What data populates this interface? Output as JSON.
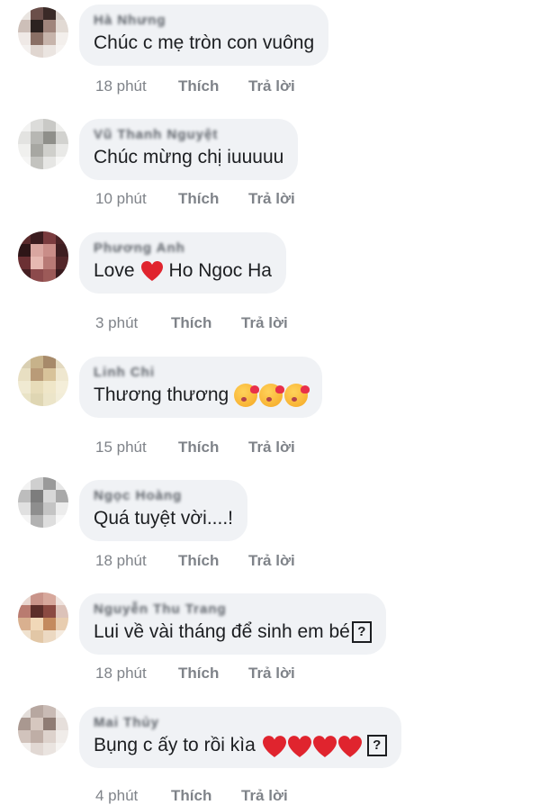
{
  "comments": [
    {
      "author": "Hà Nhưng",
      "text": "Chúc c mẹ tròn con vuông",
      "time": "18 phút",
      "like": "Thích",
      "reply": "Trả lời"
    },
    {
      "author": "Vũ Thanh Nguyệt",
      "text": "Chúc mừng chị iuuuuu",
      "time": "10 phút",
      "like": "Thích",
      "reply": "Trả lời"
    },
    {
      "author": "Phương Anh",
      "text_before": "Love",
      "text_after": "Ho Ngoc Ha",
      "time": "3 phút",
      "like": "Thích",
      "reply": "Trả lời"
    },
    {
      "author": "Linh Chi",
      "text": "Thương thương",
      "time": "15 phút",
      "like": "Thích",
      "reply": "Trả lời"
    },
    {
      "author": "Ngọc Hoàng",
      "text": "Quá tuyệt vời....!",
      "time": "18 phút",
      "like": "Thích",
      "reply": "Trả lời"
    },
    {
      "author": "Nguyễn Thu Trang",
      "text": "Lui về vài tháng để sinh em bé",
      "time": "18 phút",
      "like": "Thích",
      "reply": "Trả lời"
    },
    {
      "author": "Mai Thủy",
      "text": "Bụng c ấy to rồi kìa",
      "time": "4 phút",
      "like": "Thích",
      "reply": "Trả lời"
    }
  ],
  "glyphs": {
    "missing_char": "?"
  },
  "colors": {
    "bubble": "#f0f2f5",
    "heart": "#e0242e",
    "meta_text": "#7f8389"
  }
}
